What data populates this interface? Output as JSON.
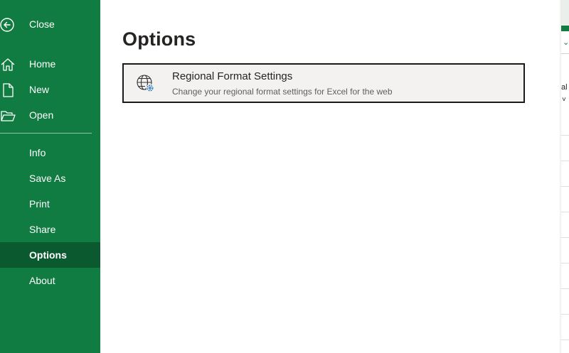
{
  "sidebar": {
    "items": [
      {
        "label": "Close",
        "icon": "back-arrow-icon"
      },
      {
        "label": "Home",
        "icon": "home-icon"
      },
      {
        "label": "New",
        "icon": "new-document-icon"
      },
      {
        "label": "Open",
        "icon": "folder-open-icon"
      },
      {
        "label": "Info"
      },
      {
        "label": "Save As"
      },
      {
        "label": "Print"
      },
      {
        "label": "Share"
      },
      {
        "label": "Options",
        "active": true
      },
      {
        "label": "About"
      }
    ]
  },
  "main": {
    "title": "Options",
    "card": {
      "title": "Regional Format Settings",
      "description": "Change your regional format settings for Excel for the web",
      "icon": "globe-settings-icon"
    }
  },
  "peek": {
    "fragment_text": "al"
  },
  "colors": {
    "sidebar_bg": "#107c41",
    "sidebar_active": "#0b5a2f",
    "card_bg": "#f3f2f1"
  }
}
